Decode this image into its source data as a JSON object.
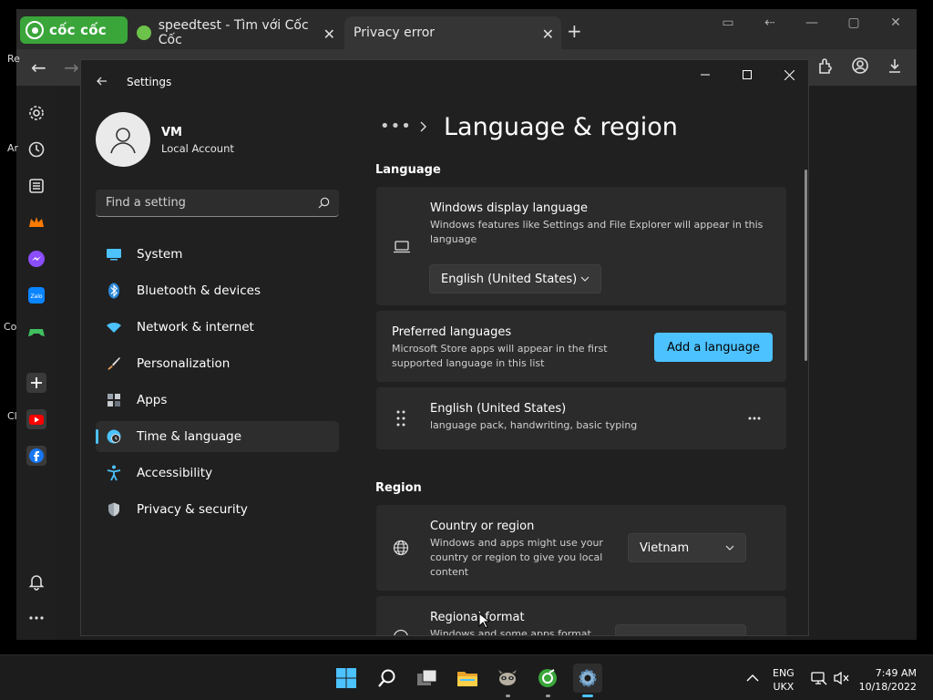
{
  "browser": {
    "logo_text": "cốc cốc",
    "tabs": [
      {
        "label": "speedtest - Tìm với Cốc Cốc"
      },
      {
        "label": "Privacy error"
      }
    ]
  },
  "left_strip": [
    "Re",
    "Ar",
    "Co",
    "Cl"
  ],
  "settings": {
    "window_title": "Settings",
    "profile": {
      "name": "VM",
      "account_type": "Local Account"
    },
    "search": {
      "placeholder": "Find a setting"
    },
    "nav": [
      {
        "id": "system",
        "label": "System",
        "icon": "monitor-icon",
        "color": "#4cc2ff"
      },
      {
        "id": "bluetooth",
        "label": "Bluetooth & devices",
        "icon": "bluetooth-icon",
        "color": "#2b88d8"
      },
      {
        "id": "network",
        "label": "Network & internet",
        "icon": "wifi-icon",
        "color": "#4cc2ff"
      },
      {
        "id": "personalization",
        "label": "Personalization",
        "icon": "brush-icon",
        "color": "#e8a05a"
      },
      {
        "id": "apps",
        "label": "Apps",
        "icon": "apps-icon",
        "color": "#9aa3ad"
      },
      {
        "id": "time-language",
        "label": "Time & language",
        "icon": "globe-clock-icon",
        "color": "#4cc2ff",
        "selected": true
      },
      {
        "id": "accessibility",
        "label": "Accessibility",
        "icon": "accessibility-icon",
        "color": "#4cc2ff"
      },
      {
        "id": "privacy",
        "label": "Privacy & security",
        "icon": "shield-icon",
        "color": "#9aa3ad"
      }
    ],
    "page": {
      "breadcrumb_more": "•••",
      "title": "Language & region",
      "language_section": "Language",
      "display_language": {
        "title": "Windows display language",
        "description": "Windows features like Settings and File Explorer will appear in this language",
        "value": "English (United States)"
      },
      "preferred_languages": {
        "title": "Preferred languages",
        "description": "Microsoft Store apps will appear in the first supported language in this list",
        "button": "Add a language"
      },
      "language_entry": {
        "title": "English (United States)",
        "description": "language pack, handwriting, basic typing"
      },
      "region_section": "Region",
      "country": {
        "title": "Country or region",
        "description": "Windows and apps might use your country or region to give you local content",
        "value": "Vietnam"
      },
      "regional_format": {
        "title": "Regional format",
        "description": "Windows and some apps format"
      }
    }
  },
  "taskbar": {
    "lang_line1": "ENG",
    "lang_line2": "UKX",
    "time": "7:49 AM",
    "date": "10/18/2022"
  }
}
